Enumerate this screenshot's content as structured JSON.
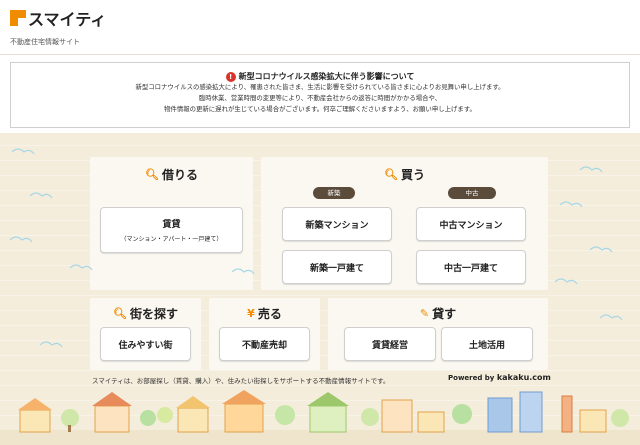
{
  "header": {
    "logo_text": "スマイティ",
    "logo_sub": "不動産住宅情報サイト"
  },
  "notice": {
    "title": "新型コロナウイルス感染拡大に伴う影響について",
    "lines": [
      "新型コロナウイルスの感染拡大により、罹患された皆さま、生活に影響を受けられている皆さまに心よりお見舞い申し上げます。",
      "臨時休業、営業時間の変更等により、不動産会社からの返答に時間がかかる場合や、",
      "物件情報の更新に遅れが生じている場合がございます。何卒ご理解くださいますよう、お願い申し上げます。"
    ]
  },
  "rent": {
    "title": "借りる",
    "button_label": "賃貸",
    "button_sub": "（マンション・アパート・一戸建て）"
  },
  "buy": {
    "title": "買う",
    "new_label": "新築",
    "used_label": "中古",
    "new_mansion": "新築マンション",
    "used_mansion": "中古マンション",
    "new_house": "新築一戸建て",
    "used_house": "中古一戸建て"
  },
  "town": {
    "title": "街を探す",
    "button": "住みやすい街"
  },
  "sell": {
    "title": "売る",
    "icon": "¥",
    "button": "不動産売却"
  },
  "lend": {
    "title": "貸す",
    "button_manage": "賃貸経営",
    "button_land": "土地活用"
  },
  "footer": {
    "description": "スマイティは、お部屋探し（賃貸、購入）や、住みたい街探しをサポートする不動産情報サイトです。",
    "powered_prefix": "Powered by",
    "powered_brand": "kakaku.com"
  },
  "colors": {
    "accent": "#f08c00",
    "background": "#f5eddc",
    "pill": "#5a4b3a",
    "alert": "#d9342b"
  }
}
